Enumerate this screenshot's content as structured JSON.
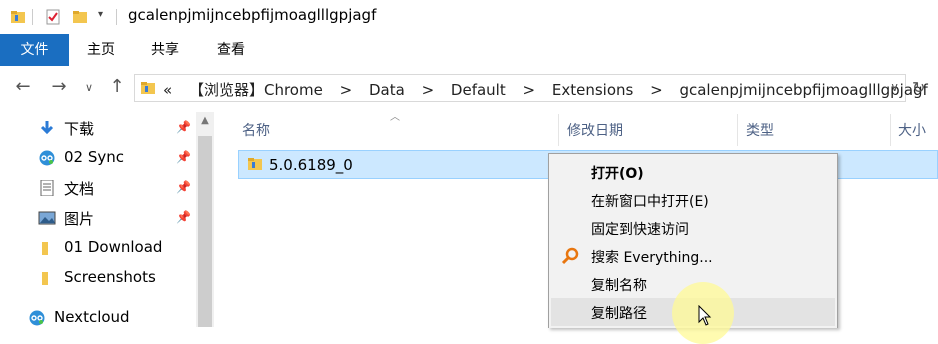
{
  "window": {
    "title": "gcalenpjmijncebpfijmoaglllgpjagf"
  },
  "ribbon": {
    "tabs": [
      "文件",
      "主页",
      "共享",
      "查看"
    ]
  },
  "address": {
    "chevron": "«",
    "segments": [
      "【浏览器】Chrome",
      ">",
      "Data",
      ">",
      "Default",
      ">",
      "Extensions",
      ">",
      "gcalenpjmijncebpfijmoaglllgpjagf"
    ]
  },
  "sidebar": {
    "items": [
      {
        "label": "下载",
        "icon": "download-icon",
        "pinned": true
      },
      {
        "label": "02 Sync",
        "icon": "nextcloud-icon",
        "pinned": true
      },
      {
        "label": "文档",
        "icon": "document-icon",
        "pinned": true
      },
      {
        "label": "图片",
        "icon": "picture-icon",
        "pinned": true
      },
      {
        "label": "01 Download",
        "icon": "folder-icon",
        "pinned": false
      },
      {
        "label": "Screenshots",
        "icon": "folder-icon",
        "pinned": false
      },
      {
        "label": "Nextcloud",
        "icon": "nextcloud-icon",
        "pinned": false
      }
    ]
  },
  "columns": [
    "名称",
    "修改日期",
    "类型",
    "大小"
  ],
  "files": [
    {
      "name": "5.0.6189_0",
      "selected": true
    }
  ],
  "context_menu": {
    "items": [
      {
        "label": "打开(O)",
        "bold": true
      },
      {
        "label": "在新窗口中打开(E)"
      },
      {
        "label": "固定到快速访问"
      },
      {
        "label": "搜索 Everything...",
        "icon": "search-icon"
      },
      {
        "label": "复制名称"
      },
      {
        "label": "复制路径",
        "highlighted": true
      }
    ]
  },
  "colors": {
    "accent": "#1a6ec1",
    "selection": "#cce8ff",
    "folder": "#f3c64f"
  }
}
